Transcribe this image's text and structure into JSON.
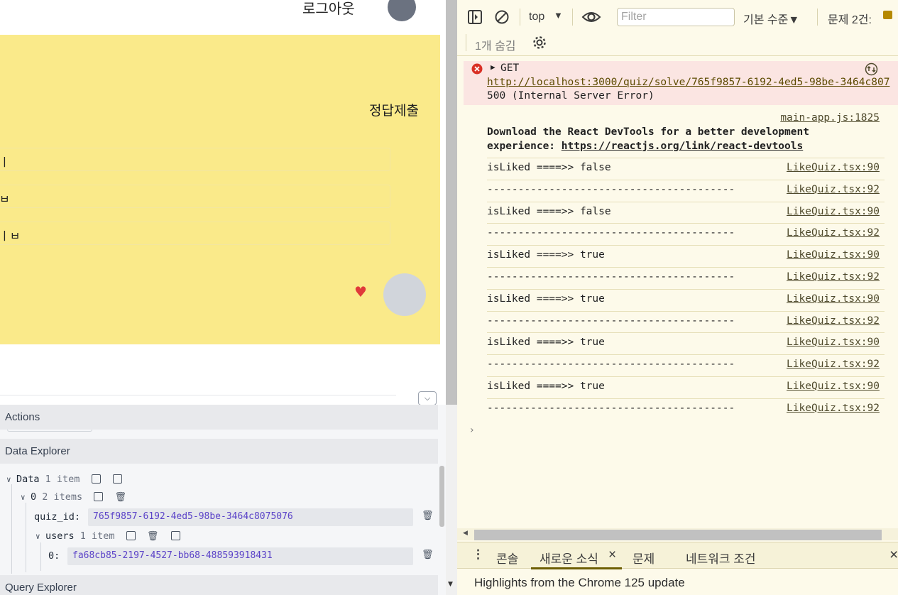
{
  "app": {
    "logout_label": "로그아웃",
    "submit_label": "정답제출",
    "options": [
      "ㅣ",
      "ㅂ",
      "ㅣㅂ"
    ]
  },
  "devpanel": {
    "actions_title": "Actions",
    "data_explorer_title": "Data Explorer",
    "query_explorer_title": "Query Explorer",
    "tree": {
      "root_label": "Data",
      "root_count": "1 item",
      "item0_label": "0",
      "item0_count": "2 items",
      "quiz_id_key": "quiz_id:",
      "quiz_id_value": "765f9857-6192-4ed5-98be-3464c8075076",
      "users_key": "users",
      "users_count": "1 item",
      "user0_key": "0:",
      "user0_value": "fa68cb85-2197-4527-bb68-488593918431"
    }
  },
  "devtools": {
    "context": "top",
    "filter_placeholder": "Filter",
    "level": "기본 수준▼",
    "issues": "문제 2건:",
    "hidden_count": "1개 숨김",
    "error": {
      "method": "GET",
      "url": "http://localhost:3000/quiz/solve/765f9857-6192-4ed5-98be-3464c807",
      "status": "500 (Internal Server Error)"
    },
    "react_notice": {
      "source": "main-app.js:1825",
      "text_line1": "Download the React DevTools for a better development",
      "text_line2_prefix": "experience: ",
      "link": "https://reactjs.org/link/react-devtools"
    },
    "logs": [
      {
        "text": "isLiked ====>> false",
        "source": "LikeQuiz.tsx:90"
      },
      {
        "text": "----------------------------------------",
        "source": "LikeQuiz.tsx:92"
      },
      {
        "text": "isLiked ====>> false",
        "source": "LikeQuiz.tsx:90"
      },
      {
        "text": "----------------------------------------",
        "source": "LikeQuiz.tsx:92"
      },
      {
        "text": "isLiked ====>> true",
        "source": "LikeQuiz.tsx:90"
      },
      {
        "text": "----------------------------------------",
        "source": "LikeQuiz.tsx:92"
      },
      {
        "text": "isLiked ====>> true",
        "source": "LikeQuiz.tsx:90"
      },
      {
        "text": "----------------------------------------",
        "source": "LikeQuiz.tsx:92"
      },
      {
        "text": "isLiked ====>> true",
        "source": "LikeQuiz.tsx:90"
      },
      {
        "text": "----------------------------------------",
        "source": "LikeQuiz.tsx:92"
      },
      {
        "text": "isLiked ====>> true",
        "source": "LikeQuiz.tsx:90"
      },
      {
        "text": "----------------------------------------",
        "source": "LikeQuiz.tsx:92"
      }
    ],
    "drawer_tabs": [
      "콘솔",
      "새로운 소식",
      "문제",
      "네트워크 조건"
    ],
    "highlights_text": "Highlights from the Chrome 125 update"
  }
}
